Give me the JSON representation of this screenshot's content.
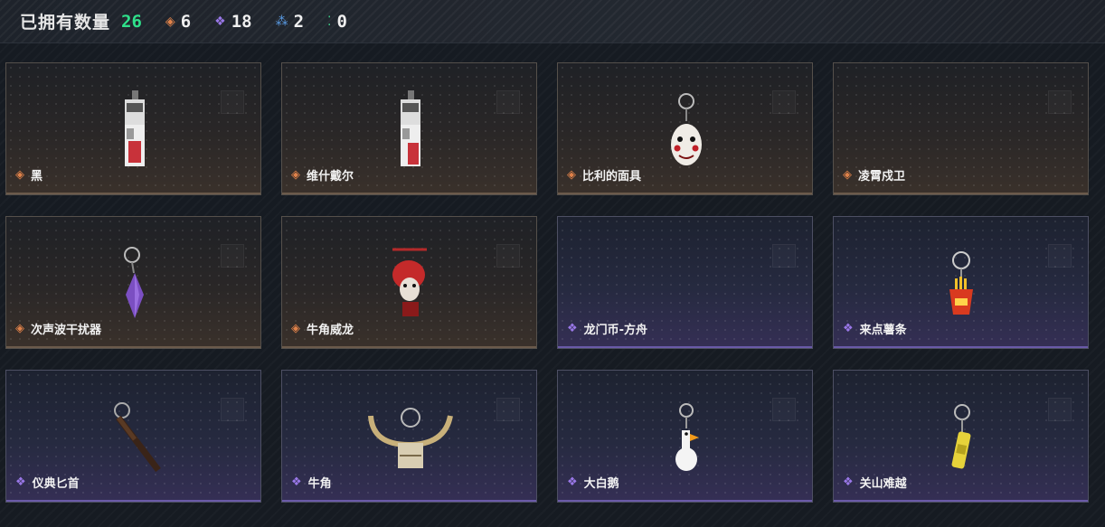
{
  "header": {
    "owned_label": "已拥有数量",
    "owned_total": "26",
    "rarity_counts": [
      {
        "icon": "orange-diamond-icon",
        "symbol": "◈",
        "color": "#e0824a",
        "value": "6"
      },
      {
        "icon": "purple-diamond-icon",
        "symbol": "❖",
        "color": "#9a78e8",
        "value": "18"
      },
      {
        "icon": "blue-triangle-icon",
        "symbol": "⁂",
        "color": "#5b9ee8",
        "value": "2"
      },
      {
        "icon": "green-dots-icon",
        "symbol": "⁚",
        "color": "#3fd08a",
        "value": "0"
      }
    ]
  },
  "cards": [
    {
      "name": "黑",
      "rarity": "orange",
      "item": "rectangular-red-white-card-charm"
    },
    {
      "name": "维什戴尔",
      "rarity": "orange",
      "item": "rectangular-red-white-card-charm"
    },
    {
      "name": "比利的面具",
      "rarity": "orange",
      "item": "white-mask-keychain"
    },
    {
      "name": "凌霄戍卫",
      "rarity": "orange",
      "item": ""
    },
    {
      "name": "次声波干扰器",
      "rarity": "orange",
      "item": "purple-crystal-keychain"
    },
    {
      "name": "牛角威龙",
      "rarity": "orange",
      "item": "red-dragon-figure-keychain"
    },
    {
      "name": "龙门币-方舟",
      "rarity": "purple",
      "item": ""
    },
    {
      "name": "来点薯条",
      "rarity": "purple",
      "item": "fries-box-keychain"
    },
    {
      "name": "仪典匕首",
      "rarity": "purple",
      "item": "dagger-keychain"
    },
    {
      "name": "牛角",
      "rarity": "purple",
      "item": "horns-keychain"
    },
    {
      "name": "大白鹅",
      "rarity": "purple",
      "item": "white-goose-keychain"
    },
    {
      "name": "关山难越",
      "rarity": "purple",
      "item": "yellow-can-keychain"
    }
  ]
}
